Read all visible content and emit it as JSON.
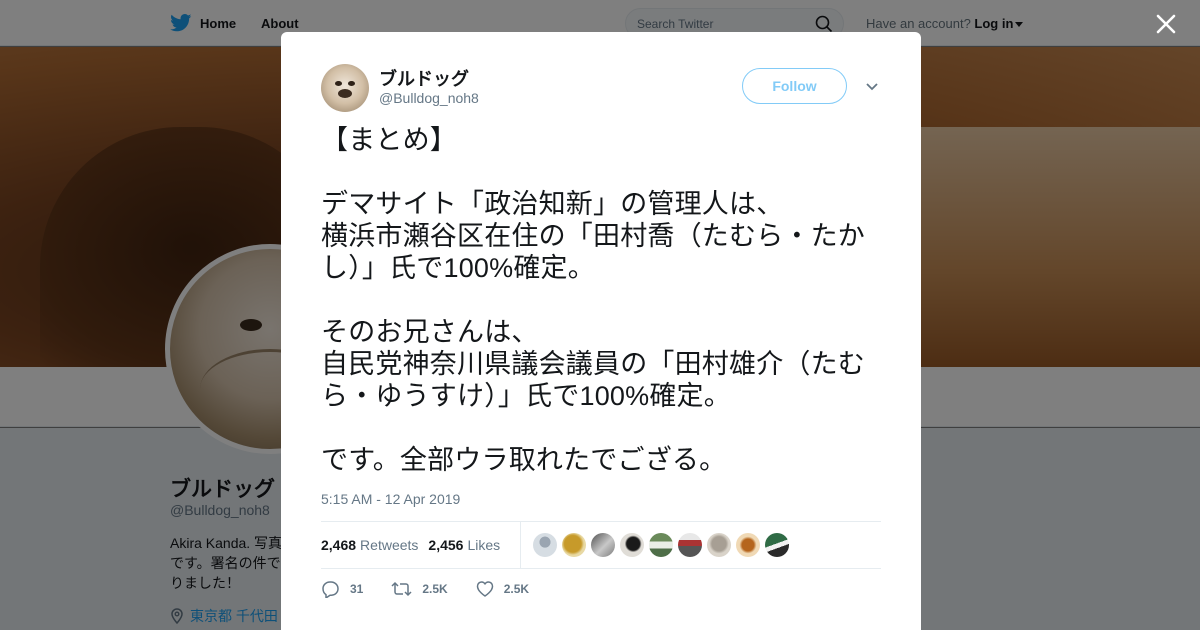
{
  "nav": {
    "home_label": "Home",
    "about_label": "About",
    "search_placeholder": "Search Twitter",
    "account_prompt": "Have an account?",
    "login_label": "Log in"
  },
  "profile": {
    "name": "ブルドッグ",
    "handle": "@Bulldog_noh8",
    "bio": "Akira Kanda. 写真\nです。署名の件で\nりました！",
    "location": "東京都 千代田"
  },
  "tweet": {
    "author_name": "ブルドッグ",
    "author_handle": "@Bulldog_noh8",
    "follow_label": "Follow",
    "text": "【まとめ】\n\nデマサイト「政治知新」の管理人は、\n横浜市瀬谷区在住の「田村喬（たむら・たか\nし）」氏で100%確定。\n\nそのお兄さんは、\n自民党神奈川県議会議員の「田村雄介（たむ\nら・ゆうすけ）」氏で100%確定。\n\nです。全部ウラ取れたでござる。",
    "timestamp": "5:15 AM - 12 Apr 2019",
    "retweets_count": "2,468",
    "retweets_label": "Retweets",
    "likes_count": "2,456",
    "likes_label": "Likes",
    "reply_count": "31",
    "retweet_action_count": "2.5K",
    "like_action_count": "2.5K"
  },
  "colors": {
    "brand": "#1da1f2",
    "text": "#14171a",
    "secondary": "#657786"
  },
  "icons": [
    "twitter-bird-icon",
    "search-icon",
    "close-icon",
    "chevron-down-icon",
    "reply-icon",
    "retweet-icon",
    "heart-icon",
    "location-pin-icon"
  ]
}
